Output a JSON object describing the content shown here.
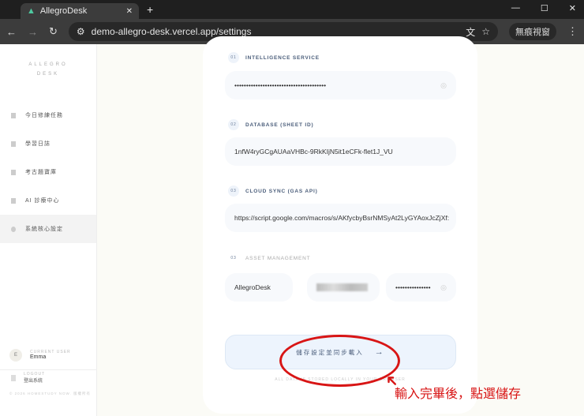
{
  "browser": {
    "tab_title": "AllegroDesk",
    "url": "demo-allegro-desk.vercel.app/settings",
    "incognito_label": "無痕視窗"
  },
  "sidebar": {
    "logo_line1": "ALLEGRO",
    "logo_line2": "DESK",
    "items": [
      {
        "label": "今日修練任務"
      },
      {
        "label": "學習日誌"
      },
      {
        "label": "考古題寶庫"
      },
      {
        "label": "AI 診療中心"
      },
      {
        "label": "系統核心設定"
      }
    ],
    "user_caption": "CURRENT USER",
    "user_name": "Emma",
    "avatar_initial": "E",
    "logout_caption": "LOGOUT",
    "logout_label": "登出系統",
    "copyright": "© 2026 HOMESTUDY NOW. 版權所有"
  },
  "settings": {
    "sections": [
      {
        "num": "01",
        "label": "INTELLIGENCE SERVICE",
        "value": "•••••••••••••••••••••••••••••••••••••••"
      },
      {
        "num": "02",
        "label": "DATABASE (SHEET ID)",
        "value": "1nfW4ryGCgAUAaVHBc-9RkKIjN5it1eCFk-flet1J_VU"
      },
      {
        "num": "03",
        "label": "CLOUD SYNC (GAS API)",
        "value": "https://script.google.com/macros/s/AKfycbyBsrNMSyAt2LyGYAoxJcZjXf:"
      },
      {
        "num": "03",
        "label": "ASSET MANAGEMENT"
      }
    ],
    "asset_name": "AllegroDesk",
    "asset_password": "•••••••••••••••",
    "save_label": "儲存設定並同步載入",
    "save_arrow": "→",
    "note": "ALL DATA IS STORED LOCALLY IN YOUR BROWSER"
  },
  "annotation": "輸入完畢後，點選儲存"
}
